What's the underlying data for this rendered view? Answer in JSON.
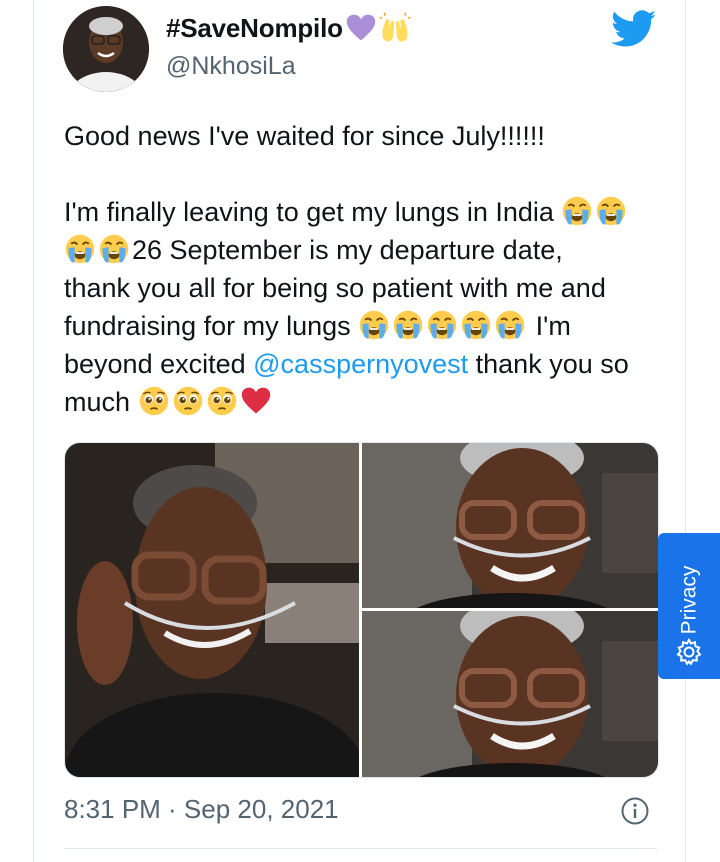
{
  "tweet": {
    "display_name": "#SaveNompilo",
    "name_emoji": [
      "purple-heart",
      "raising-hands"
    ],
    "handle": "@NkhosiLa",
    "paragraph_1": "Good news I've waited for since July!!!!!!",
    "p2_line_1": "I'm finally leaving to get my lungs in India",
    "p2_line_2": "26 September is my departure date,",
    "p2_line_3": "thank you all for being so patient with me and",
    "p2_line_4a": "fundraising for my lungs",
    "p2_line_4b": " I'm",
    "p2_line_5a": "beyond excited ",
    "mention": "@casspernyovest",
    "p2_line_5b": " thank you so",
    "p2_line_6": "much",
    "timestamp": "8:31 PM · Sep 20, 2021",
    "photos": [
      "selfie-in-car",
      "selfie-smiling-top",
      "selfie-smiling-bottom"
    ]
  },
  "privacy_widget": {
    "label": "Privacy"
  },
  "colors": {
    "link": "#1d9bf0",
    "twitter_blue": "#1d9bf0",
    "secondary_text": "#536471",
    "privacy_blue": "#1a73e8"
  }
}
